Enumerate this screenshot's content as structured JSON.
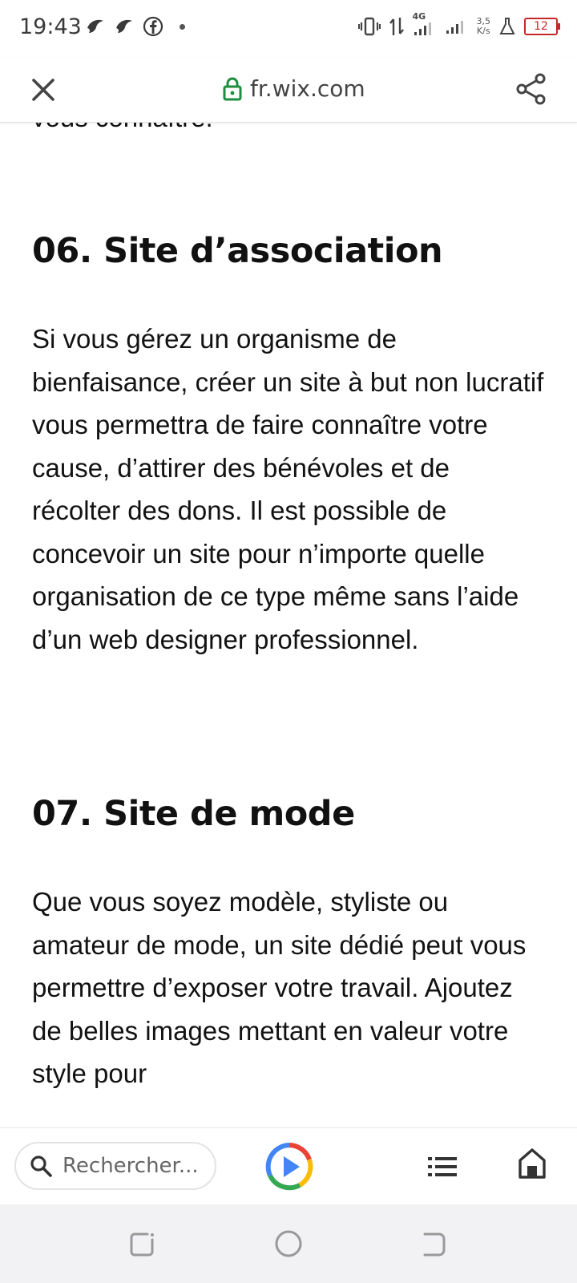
{
  "status_bar": {
    "time": "19:43",
    "network_type": "4G",
    "net_speed_value": "3,5",
    "net_speed_unit": "K/s",
    "battery_level": "12"
  },
  "browser": {
    "url": "fr.wix.com"
  },
  "article": {
    "previous_line_fragment": "vous connaître.",
    "sections": [
      {
        "heading": "06. Site d’association",
        "body": "Si vous gérez un organisme de bienfaisance, créer un site à but non lucratif vous permettra de faire connaître votre cause, d’attirer des bénévoles et de récolter des dons. Il est possible de concevoir un site pour n’importe quelle organisation de ce type même sans l’aide d’un web designer professionnel."
      },
      {
        "heading": "07. Site de mode",
        "body": "Que vous soyez modèle, styliste ou amateur de mode, un site dédié peut vous permettre d’exposer votre travail. Ajoutez de belles images mettant en valeur votre style pour"
      }
    ]
  },
  "bottom_toolbar": {
    "search_placeholder": "Rechercher..."
  },
  "colors": {
    "lock_green": "#1e8e3e",
    "battery_red": "#c62828",
    "text_primary": "#121212"
  }
}
